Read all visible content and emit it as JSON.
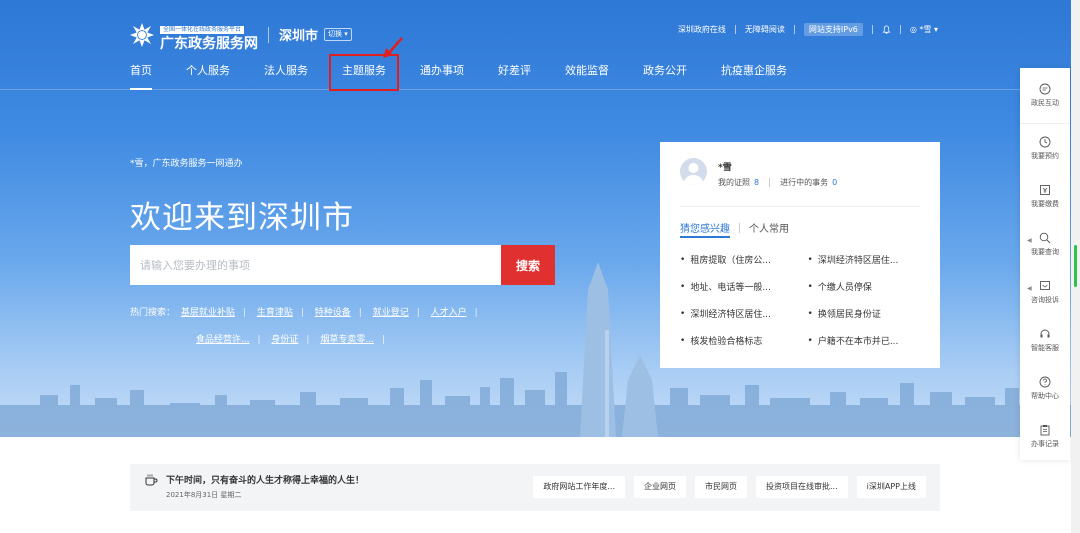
{
  "header": {
    "logo_small": "全国一体化在线政务服务平台",
    "logo_title": "广东政务服务网",
    "city": "深圳市",
    "switch_label": "切换",
    "top_links": [
      "深圳政府在线",
      "无障碍阅读",
      "网站支持IPv6"
    ],
    "user_short": "*雪"
  },
  "nav": {
    "items": [
      "首页",
      "个人服务",
      "法人服务",
      "主题服务",
      "通办事项",
      "好差评",
      "效能监督",
      "政务公开",
      "抗疫惠企服务"
    ]
  },
  "hero": {
    "greeting": "*雪，广东政务服务一网通办",
    "welcome": "欢迎来到深圳市",
    "search_placeholder": "请输入您要办理的事项",
    "search_button": "搜索",
    "hot_label": "热门搜索：",
    "hot_items": [
      "基层就业补贴",
      "生育津贴",
      "特种设备",
      "就业登记",
      "人才入户",
      "食品经营许...",
      "身份证",
      "烟草专卖零..."
    ]
  },
  "card": {
    "username": "*雪",
    "license_label": "我的证照",
    "license_count": "8",
    "inprogress_label": "进行中的事务",
    "inprogress_count": "0",
    "tab_active": "猜您感兴趣",
    "tab_other": "个人常用",
    "interests": [
      "租房提取（住房公...",
      "深圳经济特区居住...",
      "地址、电话等一般...",
      "个缴人员停保",
      "深圳经济特区居住...",
      "换领居民身份证",
      "核发检验合格标志",
      "户籍不在本市并已..."
    ]
  },
  "float": {
    "items": [
      "政民互动",
      "我要预约",
      "我要缴费",
      "我要查询",
      "咨询投诉",
      "智能客服",
      "帮助中心",
      "办事记录"
    ]
  },
  "notice": {
    "title": "下午时间，只有奋斗的人生才称得上幸福的人生！",
    "date": "2021年8月31日 星期二",
    "links": [
      "政府网站工作年度...",
      "企业网页",
      "市民网页",
      "投资项目在线审批...",
      "i深圳APP上线"
    ]
  },
  "colors": {
    "brand_blue": "#2e78d6",
    "search_red": "#e03030",
    "highlight_red": "#e02020"
  }
}
